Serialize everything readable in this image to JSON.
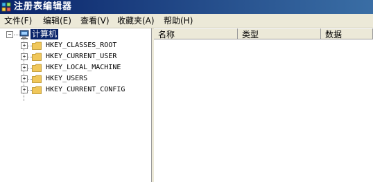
{
  "window": {
    "title": "注册表编辑器",
    "icon": "regedit-icon"
  },
  "menu": [
    {
      "label": "文件(F)"
    },
    {
      "label": "编辑(E)"
    },
    {
      "label": "查看(V)"
    },
    {
      "label": "收藏夹(A)"
    },
    {
      "label": "帮助(H)"
    }
  ],
  "tree": {
    "root": {
      "label": "计算机",
      "expander": "−",
      "icon": "computer-icon"
    },
    "keys": [
      {
        "label": "HKEY_CLASSES_ROOT",
        "expander": "+"
      },
      {
        "label": "HKEY_CURRENT_USER",
        "expander": "+"
      },
      {
        "label": "HKEY_LOCAL_MACHINE",
        "expander": "+"
      },
      {
        "label": "HKEY_USERS",
        "expander": "+"
      },
      {
        "label": "HKEY_CURRENT_CONFIG",
        "expander": "+"
      }
    ]
  },
  "list": {
    "columns": [
      {
        "label": "名称"
      },
      {
        "label": "类型"
      },
      {
        "label": "数据"
      }
    ]
  },
  "colors": {
    "titlebar": "#0a246a",
    "selection": "#0a246a",
    "chrome": "#ece9d8",
    "folder": "#f0c75a"
  }
}
